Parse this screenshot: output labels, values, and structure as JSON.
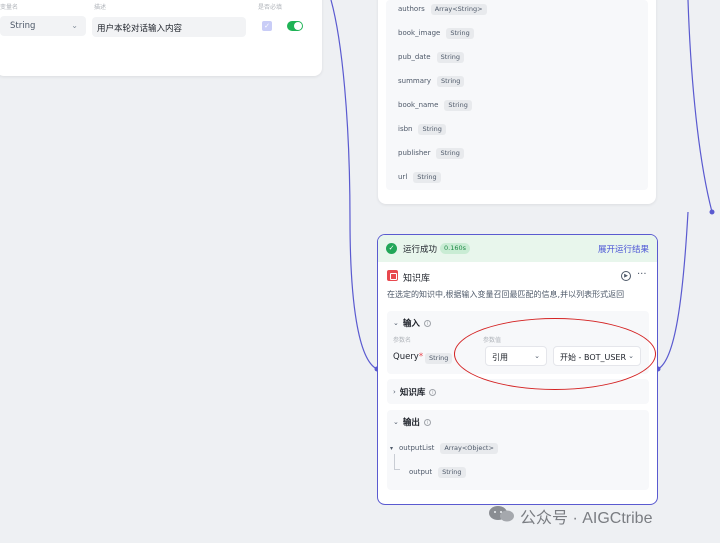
{
  "input_card": {
    "header_col1": "变量名",
    "header_col2": "描述",
    "header_col3": "是否必填",
    "type_value": "String",
    "description_value": "用户本轮对话输入内容"
  },
  "output_card": {
    "fields": [
      {
        "name": "authors",
        "type": "Array<String>"
      },
      {
        "name": "book_image",
        "type": "String"
      },
      {
        "name": "pub_date",
        "type": "String"
      },
      {
        "name": "summary",
        "type": "String"
      },
      {
        "name": "book_name",
        "type": "String"
      },
      {
        "name": "isbn",
        "type": "String"
      },
      {
        "name": "publisher",
        "type": "String"
      },
      {
        "name": "url",
        "type": "String"
      }
    ]
  },
  "node": {
    "status_text": "运行成功",
    "time": "0.160s",
    "expand_link": "展开运行结果",
    "title": "知识库",
    "description": "在选定的知识中,根据输入变量召回最匹配的信息,并以列表形式返回",
    "input_section": {
      "title": "输入",
      "param_name_header": "参数名",
      "param_value_header": "参数值",
      "param_name": "Query",
      "required_mark": "*",
      "param_type": "String",
      "ref_label": "引用",
      "ref_value": "开始 - BOT_USER"
    },
    "kb_section": {
      "title": "知识库"
    },
    "output_section": {
      "title": "输出",
      "items": [
        {
          "name": "outputList",
          "type": "Array<Object>"
        },
        {
          "name": "output",
          "type": "String"
        }
      ]
    }
  },
  "watermark": "公众号 · AIGCtribe",
  "colors": {
    "accent": "#5a5ad0",
    "success": "#22a658",
    "highlight": "#d42323",
    "toggle_on": "#1fb356"
  }
}
